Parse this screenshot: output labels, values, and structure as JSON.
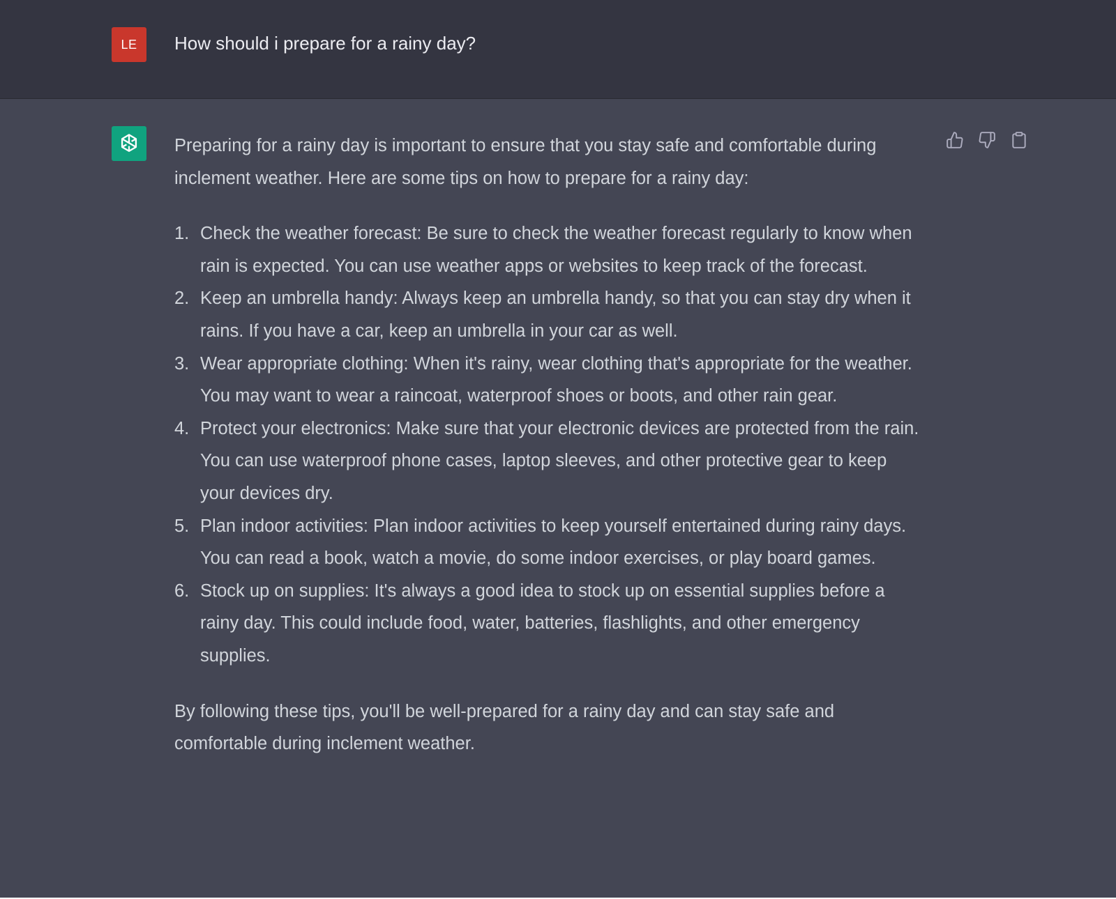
{
  "user": {
    "avatar_initials": "LE",
    "avatar_color": "#c9372c",
    "message": "How should i prepare for a rainy day?"
  },
  "assistant": {
    "avatar_icon": "openai-logo-icon",
    "avatar_color": "#10a37f",
    "intro": "Preparing for a rainy day is important to ensure that you stay safe and comfortable during inclement weather. Here are some tips on how to prepare for a rainy day:",
    "tips": [
      {
        "num": "1.",
        "text": "Check the weather forecast: Be sure to check the weather forecast regularly to know when rain is expected. You can use weather apps or websites to keep track of the forecast."
      },
      {
        "num": "2.",
        "text": "Keep an umbrella handy: Always keep an umbrella handy, so that you can stay dry when it rains. If you have a car, keep an umbrella in your car as well."
      },
      {
        "num": "3.",
        "text": "Wear appropriate clothing: When it's rainy, wear clothing that's appropriate for the weather. You may want to wear a raincoat, waterproof shoes or boots, and other rain gear."
      },
      {
        "num": "4.",
        "text": "Protect your electronics: Make sure that your electronic devices are protected from the rain. You can use waterproof phone cases, laptop sleeves, and other protective gear to keep your devices dry."
      },
      {
        "num": "5.",
        "text": "Plan indoor activities: Plan indoor activities to keep yourself entertained during rainy days. You can read a book, watch a movie, do some indoor exercises, or play board games."
      },
      {
        "num": "6.",
        "text": "Stock up on supplies: It's always a good idea to stock up on essential supplies before a rainy day. This could include food, water, batteries, flashlights, and other emergency supplies."
      }
    ],
    "conclusion": "By following these tips, you'll be well-prepared for a rainy day and can stay safe and comfortable during inclement weather."
  },
  "actions": [
    "thumbs-up-icon",
    "thumbs-down-icon",
    "clipboard-icon"
  ],
  "colors": {
    "user_bg": "#343541",
    "assistant_bg": "#444654",
    "text": "#d1d5db"
  }
}
